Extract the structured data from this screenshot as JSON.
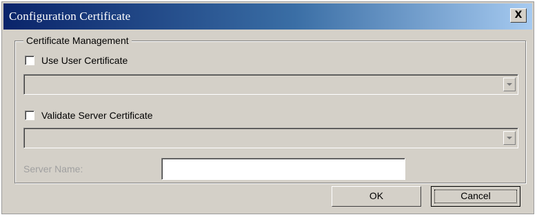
{
  "window": {
    "title": "Configuration Certificate",
    "close_label": "X"
  },
  "group": {
    "title": "Certificate Management",
    "use_user_certificate": {
      "label": "Use User Certificate",
      "checked": false
    },
    "user_certificate_select": {
      "value": ""
    },
    "validate_server_certificate": {
      "label": "Validate Server Certificate",
      "checked": false
    },
    "server_certificate_select": {
      "value": ""
    },
    "server_name": {
      "label": "Server Name:",
      "value": ""
    }
  },
  "buttons": {
    "ok_label": "OK",
    "cancel_label": "Cancel"
  }
}
